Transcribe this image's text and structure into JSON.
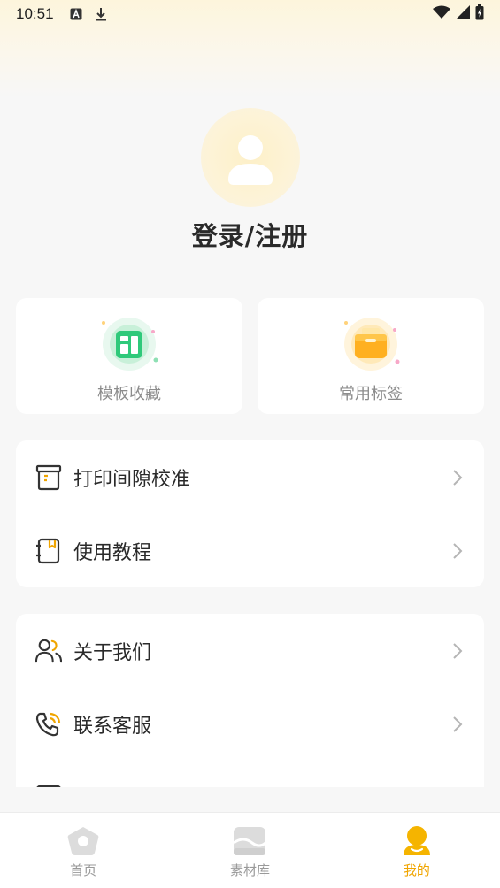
{
  "status_bar": {
    "time": "10:51",
    "icons": [
      "font-icon",
      "download-icon",
      "wifi-icon",
      "signal-icon",
      "battery-icon"
    ]
  },
  "profile": {
    "login_label": "登录/注册"
  },
  "features": [
    {
      "label": "模板收藏",
      "icon": "template-folder-icon",
      "color": "#2fc97a"
    },
    {
      "label": "常用标签",
      "icon": "label-box-icon",
      "color": "#ffb020"
    }
  ],
  "menu_group_1": [
    {
      "label": "打印间隙校准",
      "icon": "printer-calibrate-icon"
    },
    {
      "label": "使用教程",
      "icon": "tutorial-book-icon"
    }
  ],
  "menu_group_2": [
    {
      "label": "关于我们",
      "icon": "users-icon"
    },
    {
      "label": "联系客服",
      "icon": "phone-icon"
    }
  ],
  "bottom_nav": {
    "items": [
      {
        "label": "首页",
        "icon": "home-icon"
      },
      {
        "label": "素材库",
        "icon": "material-library-icon"
      },
      {
        "label": "我的",
        "icon": "profile-icon",
        "active": true
      }
    ]
  },
  "colors": {
    "accent": "#f0a500",
    "icon_gray": "#d6d6d6",
    "text_main": "#2a2a2a",
    "text_muted": "#8c8c8c"
  }
}
